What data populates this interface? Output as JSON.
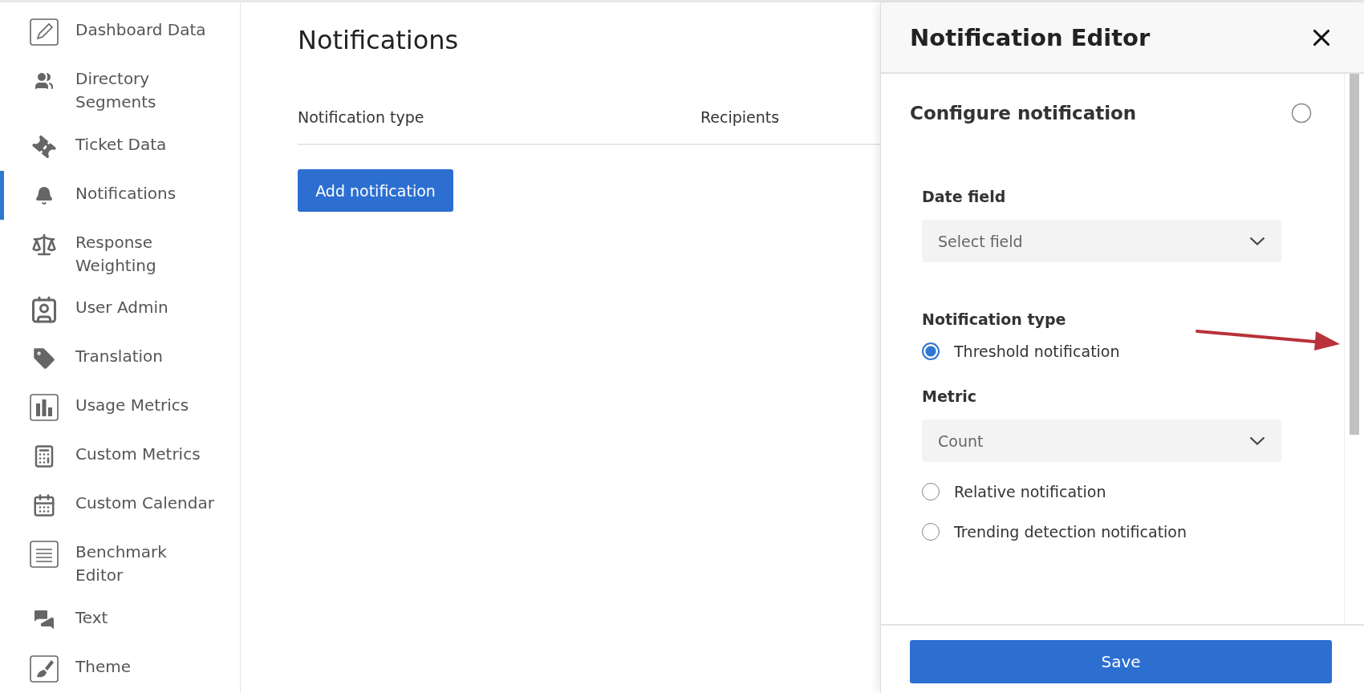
{
  "sidebar": {
    "items": [
      {
        "label": "Dashboard Data",
        "selected": false
      },
      {
        "label": "Directory Segments",
        "selected": false
      },
      {
        "label": "Ticket Data",
        "selected": false
      },
      {
        "label": "Notifications",
        "selected": true
      },
      {
        "label": "Response Weighting",
        "selected": false
      },
      {
        "label": "User Admin",
        "selected": false
      },
      {
        "label": "Translation",
        "selected": false
      },
      {
        "label": "Usage Metrics",
        "selected": false
      },
      {
        "label": "Custom Metrics",
        "selected": false
      },
      {
        "label": "Custom Calendar",
        "selected": false
      },
      {
        "label": "Benchmark Editor",
        "selected": false
      },
      {
        "label": "Text",
        "selected": false
      },
      {
        "label": "Theme",
        "selected": false
      }
    ]
  },
  "main": {
    "title": "Notifications",
    "columns": [
      "Notification type",
      "Recipients"
    ],
    "add_button": "Add notification"
  },
  "editor": {
    "title": "Notification Editor",
    "section_title": "Configure notification",
    "date_field": {
      "label": "Date field",
      "placeholder": "Select field"
    },
    "type_label": "Notification type",
    "options": [
      {
        "label": "Threshold notification",
        "selected": true,
        "metric": {
          "label": "Metric",
          "value": "Count"
        }
      },
      {
        "label": "Relative notification",
        "selected": false
      },
      {
        "label": "Trending detection notification",
        "selected": false
      }
    ],
    "save_button": "Save"
  }
}
